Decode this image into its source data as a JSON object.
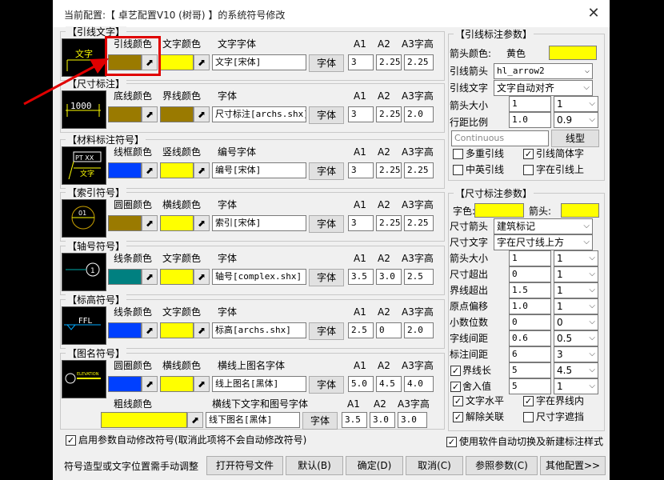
{
  "window": {
    "title": "当前配置:【 卓艺配置V10 (树哥) 】的系统符号修改",
    "close": "✕"
  },
  "groups": {
    "leader_text": {
      "title": "【引线文字】",
      "col1": "引线颜色",
      "col2": "文字颜色",
      "col3": "文字字体",
      "a1": "A1",
      "a2": "A2",
      "a3": "A3字高",
      "font_value": "文字[宋体]",
      "font_button": "字体",
      "a1_value": "3",
      "a2_value": "2.25",
      "a3_value": "2.25",
      "color1": "#9a7a00",
      "color2": "#ffff00",
      "thumb_text": "文字"
    },
    "dimension": {
      "title": "【尺寸标注】",
      "col1": "底线颜色",
      "col2": "界线颜色",
      "col3": "字体",
      "a1": "A1",
      "a2": "A2",
      "a3": "A3字高",
      "font_value": "尺寸标注[archs.shx]",
      "font_button": "字体",
      "a1_value": "3",
      "a2_value": "2.25",
      "a3_value": "2.0",
      "color1": "#9a7a00",
      "color2": "#9a7a00",
      "thumb_text": "1000"
    },
    "material": {
      "title": "【材料标注符号】",
      "col1": "线框颜色",
      "col2": "竖线颜色",
      "col3": "编号字体",
      "a1": "A1",
      "a2": "A2",
      "a3": "A3字高",
      "font_value": "编号[宋体]",
      "font_button": "字体",
      "a1_value": "3",
      "a2_value": "2.25",
      "a3_value": "2.25",
      "color1": "#0040ff",
      "color2": "#ffff00",
      "thumb_text": "PT XX",
      "thumb_text2": "文字"
    },
    "index": {
      "title": "【索引符号】",
      "col1": "圆圈颜色",
      "col2": "横线颜色",
      "col3": "字体",
      "a1": "A1",
      "a2": "A2",
      "a3": "A3字高",
      "font_value": "索引[宋体]",
      "font_button": "字体",
      "a1_value": "3",
      "a2_value": "2.25",
      "a3_value": "2.25",
      "color1": "#9a7a00",
      "color2": "#ffff00",
      "thumb_text": "01"
    },
    "axis": {
      "title": "【轴号符号】",
      "col1": "线条颜色",
      "col2": "文字颜色",
      "col3": "字体",
      "a1": "A1",
      "a2": "A2",
      "a3": "A3字高",
      "font_value": "轴号[complex.shx]",
      "font_button": "字体",
      "a1_value": "3.5",
      "a2_value": "3.0",
      "a3_value": "2.5",
      "color1": "#008080",
      "color2": "#ffff00",
      "thumb_text": "1"
    },
    "elevation": {
      "title": "【标高符号】",
      "col1": "线条颜色",
      "col2": "文字颜色",
      "col3": "字体",
      "a1": "A1",
      "a2": "A2",
      "a3": "A3字高",
      "font_value": "标高[archs.shx]",
      "font_button": "字体",
      "a1_value": "2.5",
      "a2_value": "0",
      "a3_value": "2.0",
      "color1": "#0040ff",
      "color2": "#ffff00",
      "thumb_text": "FFL"
    },
    "drawing_name": {
      "title": "【图名符号】",
      "col1": "圆圈颜色",
      "col2": "横线颜色",
      "col3": "横线上图名字体",
      "a1": "A1",
      "a2": "A2",
      "a3": "A3字高",
      "font_value": "线上图名[黑体]",
      "font_button": "字体",
      "a1_value": "5.0",
      "a2_value": "4.5",
      "a3_value": "4.0",
      "color1": "#0040ff",
      "color2": "#ffff00",
      "row2_col1": "粗线颜色",
      "row2_col3": "横线下文字和图号字体",
      "row2_font_value": "线下图名[黑体]",
      "row2_font_button": "字体",
      "row2_a1": "A1",
      "row2_a2": "A2",
      "row2_a3": "A3字高",
      "row2_a1_value": "3.5",
      "row2_a2_value": "3.0",
      "row2_a3_value": "3.0",
      "row2_color": "#ffff00",
      "thumb_text": "ELEVATION"
    }
  },
  "leader_params": {
    "title": "【引线标注参数】",
    "arrow_color_label": "箭头颜色:",
    "arrow_color_name": "黄色",
    "arrow_color": "#ffff00",
    "arrow_label": "引线箭头",
    "arrow_value": "hl_arrow2",
    "text_label": "引线文字",
    "text_value": "文字自动对齐",
    "size_label": "箭头大小",
    "size_value": "1",
    "size_select": "1",
    "spacing_label": "行距比例",
    "spacing_value": "1.0",
    "spacing_select": "0.9",
    "linetype_value": "Continuous",
    "linetype_button": "线型",
    "chk_multi": "多重引线",
    "chk_multi_state": false,
    "chk_simple": "引线简体字",
    "chk_simple_state": true,
    "chk_cn_en": "中英引线",
    "chk_cn_en_state": false,
    "chk_on_line": "字在引线上",
    "chk_on_line_state": false
  },
  "dim_params": {
    "title": "【尺寸标注参数】",
    "text_color_label": "字色:",
    "text_color": "#ffff00",
    "arrow_color_label": "箭头:",
    "arrow_color": "#ffff00",
    "arrow_label": "尺寸箭头",
    "arrow_value": "建筑标记",
    "text_label": "尺寸文字",
    "text_value": "字在尺寸线上方",
    "rows": [
      {
        "label": "箭头大小",
        "value": "1",
        "select": "1"
      },
      {
        "label": "尺寸超出",
        "value": "0",
        "select": "1"
      },
      {
        "label": "界线超出",
        "value": "1.5",
        "select": "1"
      },
      {
        "label": "原点偏移",
        "value": "1.0",
        "select": "1"
      },
      {
        "label": "小数位数",
        "value": "0",
        "select": "0"
      },
      {
        "label": "字线间距",
        "value": "0.6",
        "select": "0.5"
      },
      {
        "label": "标注间距",
        "value": "6",
        "select": "3"
      },
      {
        "label": "界线长",
        "value": "5",
        "select": "4.5"
      },
      {
        "label": "舍入值",
        "value": "5",
        "select": "1"
      }
    ],
    "chk_text_horizontal": "文字水平",
    "chk_in_boundary": "字在界线内",
    "chk_explode": "解除关联",
    "chk_mask": "尺寸字遮挡"
  },
  "footer": {
    "auto_modify": "启用参数自动修改符号(取消此项将不会自动修改符号)",
    "auto_switch": "使用软件自动切换及新建标注样式",
    "note": "符号造型或文字位置需手动调整",
    "open_file": "打开符号文件",
    "default": "默认(B)",
    "ok": "确定(D)",
    "cancel": "取消(C)",
    "ref_params": "参照参数(C)",
    "more": "其他配置>>"
  },
  "annotation_color": "#e00000"
}
